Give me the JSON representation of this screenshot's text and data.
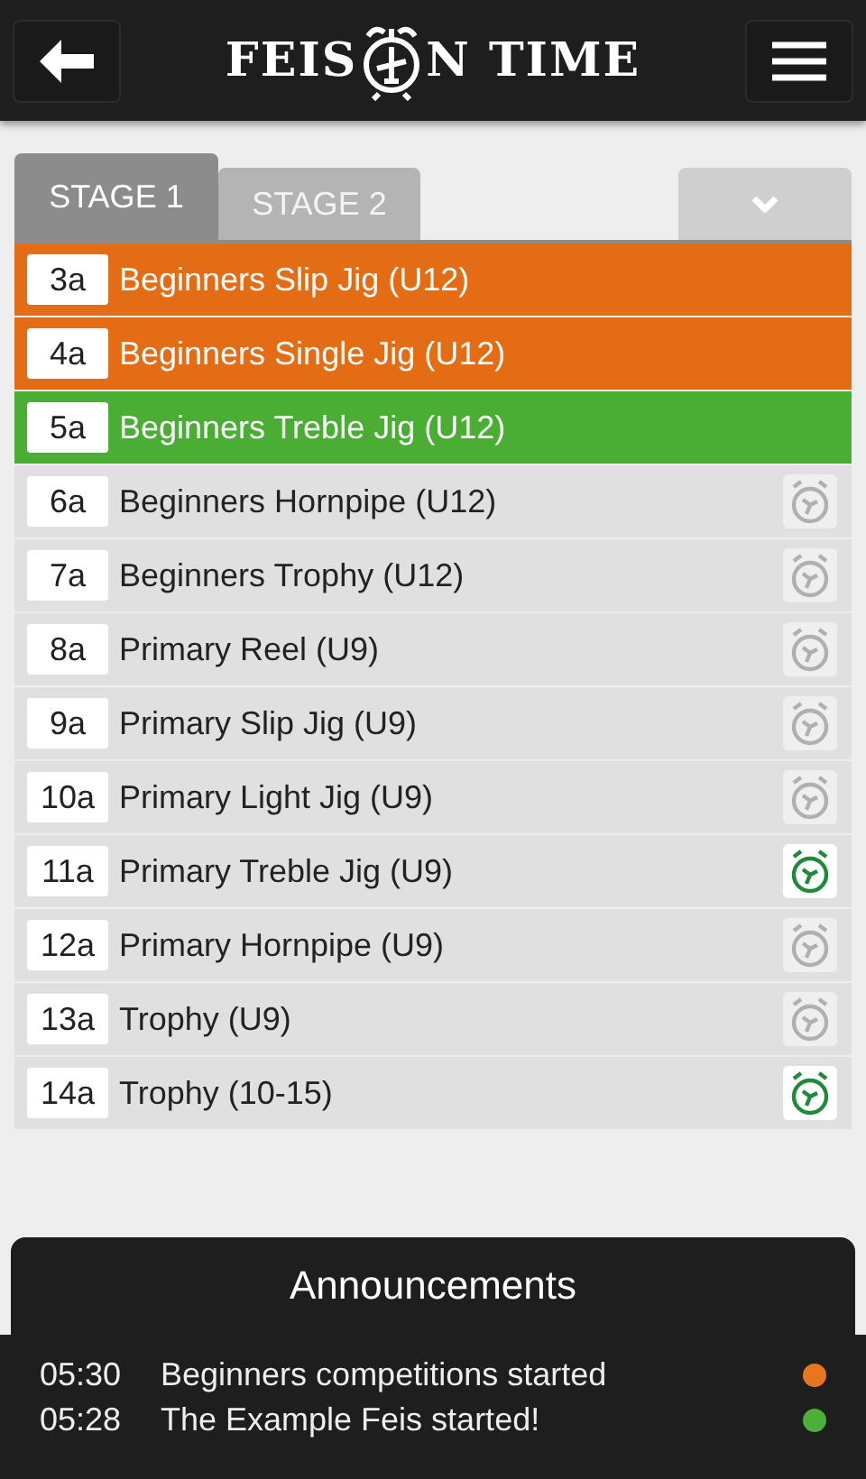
{
  "header": {
    "logo": {
      "before": "FEIS",
      "after": "N TIME"
    }
  },
  "tabs": [
    {
      "label": "STAGE 1",
      "selected": true
    },
    {
      "label": "STAGE 2",
      "selected": false
    }
  ],
  "competitions": [
    {
      "number": "3a",
      "name": "Beginners Slip Jig (U12)",
      "color": "#e46c14"
    },
    {
      "number": "4a",
      "name": "Beginners Single Jig (U12)",
      "color": "#e46c14"
    },
    {
      "number": "5a",
      "name": "Beginners Treble Jig (U12)",
      "color": "#4aae35"
    },
    {
      "number": "6a",
      "name": "Beginners Hornpipe (U12)",
      "color": "#e0e0e0",
      "alarm": false
    },
    {
      "number": "7a",
      "name": "Beginners Trophy (U12)",
      "color": "#e0e0e0",
      "alarm": false
    },
    {
      "number": "8a",
      "name": "Primary Reel (U9)",
      "color": "#e0e0e0",
      "alarm": false
    },
    {
      "number": "9a",
      "name": "Primary Slip Jig (U9)",
      "color": "#e0e0e0",
      "alarm": false
    },
    {
      "number": "10a",
      "name": "Primary Light Jig (U9)",
      "color": "#e0e0e0",
      "alarm": false
    },
    {
      "number": "11a",
      "name": "Primary Treble Jig (U9)",
      "color": "#e0e0e0",
      "alarm": true
    },
    {
      "number": "12a",
      "name": "Primary Hornpipe (U9)",
      "color": "#e0e0e0",
      "alarm": false
    },
    {
      "number": "13a",
      "name": "Trophy (U9)",
      "color": "#e0e0e0",
      "alarm": false
    },
    {
      "number": "14a",
      "name": "Trophy (10-15)",
      "color": "#e0e0e0",
      "alarm": true
    }
  ],
  "announcements": {
    "title": "Announcements",
    "items": [
      {
        "time": "05:30",
        "text": "Beginners competitions started",
        "color": "#e8761e"
      },
      {
        "time": "05:28",
        "text": "The Example Feis started!",
        "color": "#4caf3a"
      }
    ]
  }
}
